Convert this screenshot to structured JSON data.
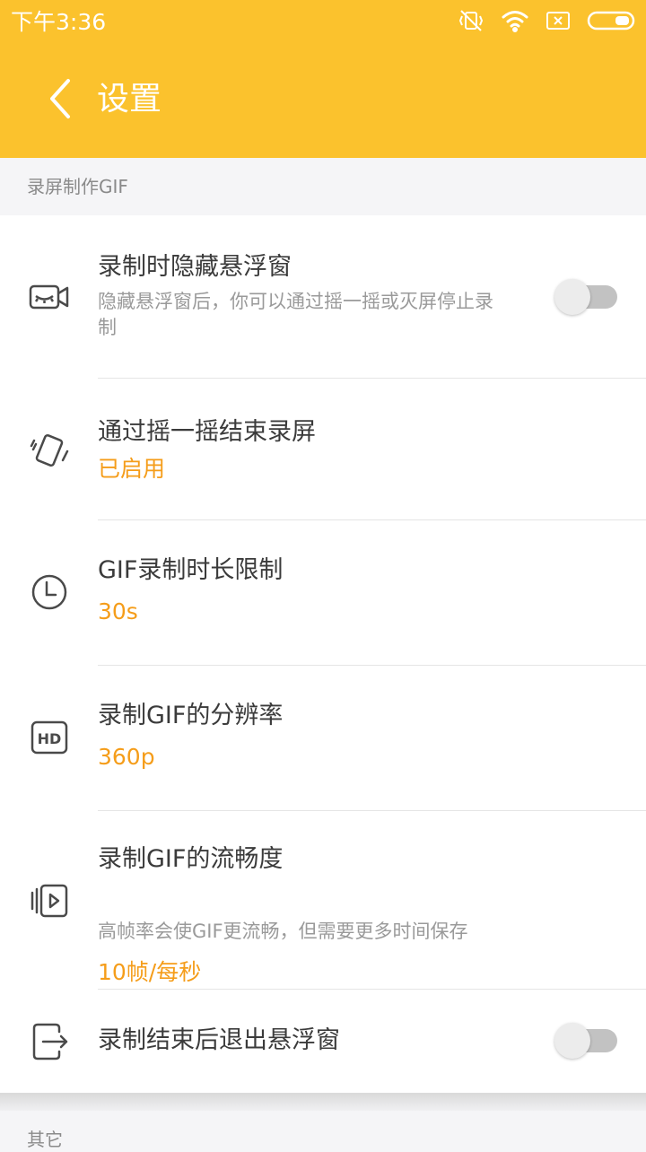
{
  "status_bar": {
    "time": "下午3:36",
    "icons": [
      "vibrate-off-icon",
      "wifi-icon",
      "sim-x-icon",
      "battery-icon"
    ]
  },
  "header": {
    "back_icon": "back-arrow-icon",
    "title": "设置"
  },
  "sections": [
    {
      "header": "录屏制作GIF",
      "items": [
        {
          "icon": "camera-eye-icon",
          "title": "录制时隐藏悬浮窗",
          "description": "隐藏悬浮窗后，你可以通过摇一摇或灭屏停止录制",
          "toggle": false
        },
        {
          "icon": "shake-phone-icon",
          "title": "通过摇一摇结束录屏",
          "value": "已启用"
        },
        {
          "icon": "clock-icon",
          "title": "GIF录制时长限制",
          "value": "30s"
        },
        {
          "icon": "hd-icon",
          "title": "录制GIF的分辨率",
          "value": "360p"
        },
        {
          "icon": "frames-icon",
          "title": "录制GIF的流畅度",
          "description": "高帧率会使GIF更流畅，但需要更多时间保存",
          "value": "10帧/每秒"
        },
        {
          "icon": "exit-icon",
          "title": "录制结束后退出悬浮窗",
          "toggle": false
        }
      ]
    },
    {
      "header": "其它",
      "items": []
    }
  ],
  "colors": {
    "accent": "#fbc22d",
    "value_text": "#f59d1a",
    "title_text": "#3b3b3b",
    "description_text": "#9a9a9a",
    "toggle_off_track": "#c2c2c2"
  }
}
